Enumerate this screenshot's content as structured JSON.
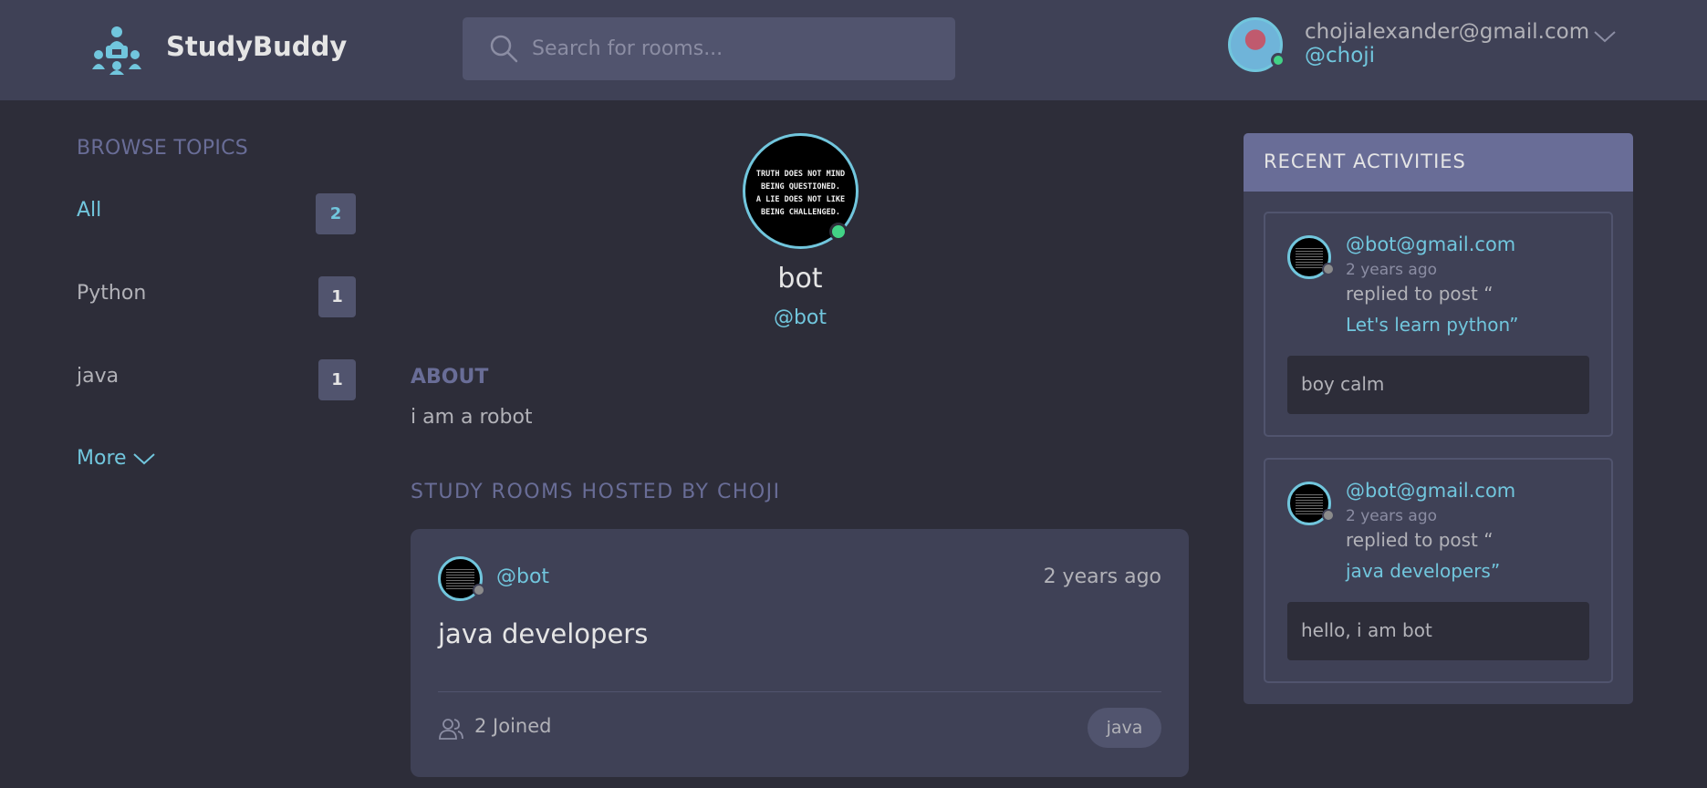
{
  "header": {
    "brand": "StudyBuddy",
    "search_placeholder": "Search for rooms...",
    "user_email": "chojialexander@gmail.com",
    "user_handle": "@choji"
  },
  "sidebar": {
    "title": "BROWSE TOPICS",
    "topics": [
      {
        "label": "All",
        "count": "2"
      },
      {
        "label": "Python",
        "count": "1"
      },
      {
        "label": "java",
        "count": "1"
      }
    ],
    "more_label": "More"
  },
  "profile": {
    "avatar_quote": [
      "TRUTH DOES NOT MIND",
      "BEING QUESTIONED.",
      "A LIE DOES NOT LIKE",
      "BEING CHALLENGED."
    ],
    "name": "bot",
    "handle": "@bot",
    "about_title": "ABOUT",
    "about_text": "i am a robot",
    "rooms_title": "STUDY ROOMS HOSTED BY CHOJI"
  },
  "rooms": [
    {
      "host": "@bot",
      "time": "2 years ago",
      "title": "java developers",
      "joined": "2 Joined",
      "topic": "java"
    }
  ],
  "activity": {
    "title": "RECENT ACTIVITIES",
    "items": [
      {
        "user": "@bot@gmail.com",
        "time": "2 years ago",
        "action": "replied to post “",
        "post": "Let's learn python”",
        "reply": "boy calm"
      },
      {
        "user": "@bot@gmail.com",
        "time": "2 years ago",
        "action": "replied to post “",
        "post": "java developers”",
        "reply": "hello, i am bot"
      }
    ]
  },
  "colors": {
    "background": "#2d2d39",
    "header": "#3f4156",
    "accent": "#71c6dd",
    "muted": "#696d97",
    "online": "#42d386"
  }
}
